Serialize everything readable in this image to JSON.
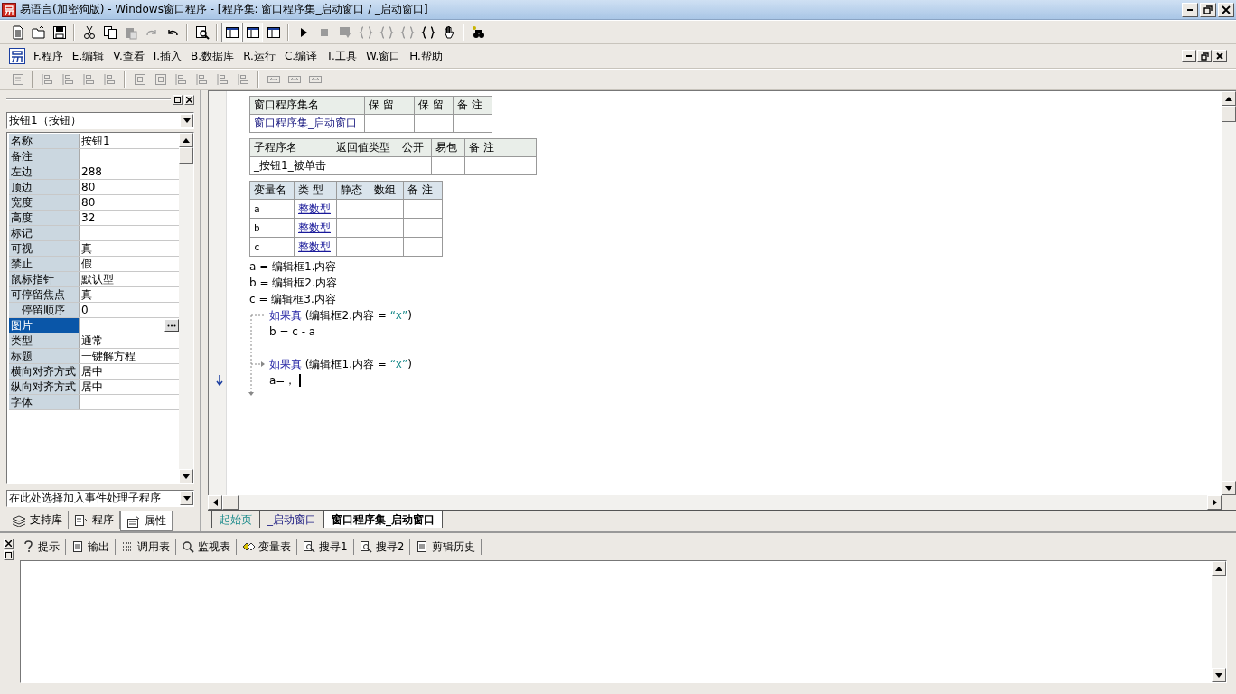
{
  "window": {
    "title": "易语言(加密狗版) - Windows窗口程序 - [程序集: 窗口程序集_启动窗口 / _启动窗口]"
  },
  "toolbar": [
    {
      "kind": "new",
      "disabled": false,
      "pressed": false
    },
    {
      "kind": "open",
      "disabled": false,
      "pressed": false
    },
    {
      "kind": "save",
      "disabled": false,
      "pressed": false
    },
    {
      "kind": "sep"
    },
    {
      "kind": "cut",
      "disabled": false,
      "pressed": false
    },
    {
      "kind": "copy",
      "disabled": false,
      "pressed": false
    },
    {
      "kind": "paste",
      "disabled": true,
      "pressed": false
    },
    {
      "kind": "redo",
      "disabled": true,
      "pressed": false
    },
    {
      "kind": "undo",
      "disabled": false,
      "pressed": false
    },
    {
      "kind": "sep"
    },
    {
      "kind": "find",
      "disabled": false,
      "pressed": false
    },
    {
      "kind": "sep"
    },
    {
      "kind": "layout",
      "disabled": false,
      "pressed": true
    },
    {
      "kind": "layout",
      "disabled": false,
      "pressed": true
    },
    {
      "kind": "layout",
      "disabled": false,
      "pressed": false
    },
    {
      "kind": "sep"
    },
    {
      "kind": "run",
      "disabled": false,
      "pressed": false
    },
    {
      "kind": "stop",
      "disabled": true,
      "pressed": false
    },
    {
      "kind": "step",
      "disabled": true,
      "pressed": false
    },
    {
      "kind": "braces",
      "disabled": true,
      "pressed": false
    },
    {
      "kind": "braces",
      "disabled": true,
      "pressed": false
    },
    {
      "kind": "braces",
      "disabled": true,
      "pressed": false
    },
    {
      "kind": "braces",
      "disabled": false,
      "pressed": false
    },
    {
      "kind": "hand",
      "disabled": false,
      "pressed": false
    },
    {
      "kind": "sep"
    },
    {
      "kind": "binoculars",
      "disabled": false,
      "pressed": false
    }
  ],
  "menu": [
    "F.程序",
    "E.编辑",
    "V.查看",
    "I.插入",
    "B.数据库",
    "R.运行",
    "C.编译",
    "T.工具",
    "W.窗口",
    "H.帮助"
  ],
  "align_toolbar": [
    {
      "kind": "grid",
      "disabled": true
    },
    {
      "kind": "sep"
    },
    {
      "kind": "align",
      "disabled": true
    },
    {
      "kind": "align",
      "disabled": true
    },
    {
      "kind": "align",
      "disabled": true
    },
    {
      "kind": "align",
      "disabled": true
    },
    {
      "kind": "sep"
    },
    {
      "kind": "center",
      "disabled": true
    },
    {
      "kind": "center",
      "disabled": true
    },
    {
      "kind": "align",
      "disabled": true
    },
    {
      "kind": "align",
      "disabled": true
    },
    {
      "kind": "align",
      "disabled": true
    },
    {
      "kind": "align",
      "disabled": true
    },
    {
      "kind": "sep"
    },
    {
      "kind": "size",
      "disabled": true
    },
    {
      "kind": "size",
      "disabled": true
    },
    {
      "kind": "size",
      "disabled": true
    }
  ],
  "properties": {
    "object": "按钮1（按钮）",
    "rows": [
      {
        "name": "名称",
        "value": "按钮1",
        "selected": false
      },
      {
        "name": "备注",
        "selected": false
      },
      {
        "name": "左边",
        "value": "288",
        "selected": false
      },
      {
        "name": "顶边",
        "value": "80",
        "selected": false
      },
      {
        "name": "宽度",
        "value": "80",
        "selected": false
      },
      {
        "name": "高度",
        "value": "32",
        "selected": false
      },
      {
        "name": "标记",
        "selected": false
      },
      {
        "name": "可视",
        "value": "真",
        "selected": false
      },
      {
        "name": "禁止",
        "value": "假",
        "selected": false
      },
      {
        "name": "鼠标指针",
        "value": "默认型",
        "selected": false
      },
      {
        "name": "可停留焦点",
        "value": "真",
        "selected": false,
        "children": [
          {
            "name": "停留顺序",
            "value": "0",
            "selected": false
          }
        ]
      },
      {
        "name": "图片",
        "selected": true,
        "kind": "picker"
      },
      {
        "name": "类型",
        "value": "通常",
        "selected": false
      },
      {
        "name": "标题",
        "value": "一键解方程",
        "selected": false
      },
      {
        "name": "横向对齐方式",
        "value": "居中",
        "selected": false
      },
      {
        "name": "纵向对齐方式",
        "value": "居中",
        "selected": false
      },
      {
        "name": "字体",
        "selected": false
      }
    ],
    "event_selector": "在此处选择加入事件处理子程序",
    "tabs": [
      {
        "label": "支持库",
        "kind": "library",
        "selected": false
      },
      {
        "label": "程序",
        "kind": "program",
        "selected": false
      },
      {
        "label": "属性",
        "kind": "properties",
        "selected": true
      }
    ]
  },
  "assembly_table": {
    "columns": [
      "窗口程序集名",
      "保 留",
      "保 留",
      "备 注"
    ],
    "row": [
      "窗口程序集_启动窗口"
    ]
  },
  "sub_table": {
    "columns": [
      "子程序名",
      "返回值类型",
      "公开",
      "易包",
      "备 注"
    ],
    "row": [
      "_按钮1_被单击"
    ]
  },
  "var_table": {
    "columns": [
      "变量名",
      "类 型",
      "静态",
      "数组",
      "备 注"
    ],
    "rows": [
      [
        "a",
        "整数型"
      ],
      [
        "b",
        "整数型"
      ],
      [
        "c",
        "整数型"
      ]
    ]
  },
  "code_lines": [
    {
      "kind": "statement",
      "cursor": false,
      "tokens": [
        {
          "kind": "plain",
          "text": "a = 编辑框1.内容"
        }
      ]
    },
    {
      "kind": "statement",
      "cursor": false,
      "tokens": [
        {
          "kind": "plain",
          "text": "b = 编辑框2.内容"
        }
      ]
    },
    {
      "kind": "statement",
      "cursor": false,
      "tokens": [
        {
          "kind": "plain",
          "text": "c = 编辑框3.内容"
        }
      ]
    },
    {
      "kind": "if",
      "cursor": false,
      "tokens": [
        {
          "kind": "keyword",
          "text": "如果真"
        },
        {
          "kind": "plain",
          "text": " (编辑框2.内容 = "
        },
        {
          "kind": "string",
          "text": "“x”"
        },
        {
          "kind": "plain",
          "text": ")"
        }
      ]
    },
    {
      "kind": "body",
      "cursor": false,
      "tokens": [
        {
          "kind": "plain",
          "text": "b = c - a"
        }
      ]
    },
    {
      "kind": "blank",
      "cursor": false
    },
    {
      "kind": "if",
      "cursor": false,
      "tokens": [
        {
          "kind": "keyword",
          "text": "如果真"
        },
        {
          "kind": "plain",
          "text": " (编辑框1.内容 = "
        },
        {
          "kind": "string",
          "text": "“x”"
        },
        {
          "kind": "plain",
          "text": ")"
        }
      ]
    },
    {
      "kind": "body",
      "cursor": true,
      "tokens": [
        {
          "kind": "plain",
          "text": "a=，"
        }
      ]
    }
  ],
  "editor_tabs": [
    {
      "label": "起始页",
      "kind": "start",
      "selected": false
    },
    {
      "label": "_启动窗口",
      "kind": "form",
      "selected": false
    },
    {
      "label": "窗口程序集_启动窗口",
      "kind": "module",
      "selected": true
    }
  ],
  "output_tabs": [
    {
      "label": "提示",
      "kind": "hint"
    },
    {
      "label": "输出",
      "kind": "output"
    },
    {
      "label": "调用表",
      "kind": "calls"
    },
    {
      "label": "监视表",
      "kind": "watch"
    },
    {
      "label": "变量表",
      "kind": "vars"
    },
    {
      "label": "搜寻1",
      "kind": "search"
    },
    {
      "label": "搜寻2",
      "kind": "search"
    },
    {
      "label": "剪辑历史",
      "kind": "clip"
    }
  ]
}
